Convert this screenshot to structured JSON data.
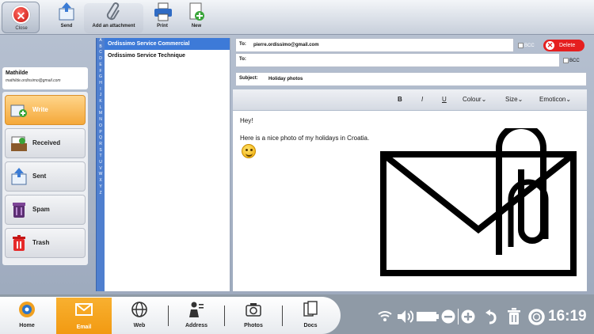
{
  "toolbar": {
    "close_label": "Close",
    "send_label": "Send",
    "attach_label": "Add an attachment",
    "print_label": "Print",
    "new_label": "New"
  },
  "user": {
    "name": "Mathilde",
    "email": "mathilde.ordissimo@gmail.com"
  },
  "folders": {
    "write": "Write",
    "received": "Received",
    "sent": "Sent",
    "spam": "Spam",
    "trash": "Trash"
  },
  "alphabet": [
    "A",
    "B",
    "C",
    "D",
    "E",
    "F",
    "G",
    "H",
    "I",
    "J",
    "K",
    "L",
    "M",
    "N",
    "O",
    "P",
    "Q",
    "R",
    "S",
    "T",
    "U",
    "V",
    "W",
    "X",
    "Y",
    "Z"
  ],
  "contacts": {
    "c1": "Ordissimo Service Commercial",
    "c2": "Ordissimo Service Technique"
  },
  "compose": {
    "to_label": "To:",
    "to_value": "pierre.ordissimo@gmail.com",
    "cc_label": "To:",
    "bcc_label": "BCC",
    "delete_label": "Delete",
    "subject_label": "Subject:",
    "subject_value": "Holiday photos",
    "fmt_bold": "B",
    "fmt_italic": "I",
    "fmt_underline": "U",
    "fmt_colour": "Colour⌄",
    "fmt_size": "Size⌄",
    "fmt_emoticon": "Emoticon⌄",
    "body_line1": "Hey!",
    "body_line2": "Here is a nice photo of my holidays in Croatia."
  },
  "taskbar": {
    "home": "Home",
    "email": "Email",
    "web": "Web",
    "address": "Address",
    "photos": "Photos",
    "docs": "Docs",
    "clock": "16:19"
  },
  "colors": {
    "accent_orange": "#f29a12",
    "delete_red": "#e51f1f",
    "selection_blue": "#3d7ad8"
  }
}
